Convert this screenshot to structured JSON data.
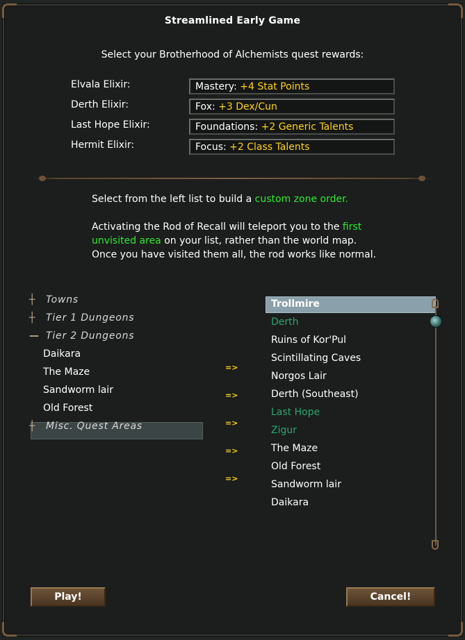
{
  "dialog": {
    "title": "Streamlined Early Game",
    "intro": "Select your Brotherhood of Alchemists quest rewards:"
  },
  "elixirs": [
    {
      "label": "Elvala Elixir:",
      "choice_prefix": "Mastery: ",
      "choice_value": "+4 Stat Points"
    },
    {
      "label": "Derth Elixir:",
      "choice_prefix": "Fox: ",
      "choice_value": "+3 Dex/Cun"
    },
    {
      "label": "Last Hope Elixir:",
      "choice_prefix": "Foundations: ",
      "choice_value": "+2 Generic Talents"
    },
    {
      "label": "Hermit Elixir:",
      "choice_prefix": "Focus: ",
      "choice_value": "+2 Class Talents"
    }
  ],
  "zone_help": {
    "line1_pre": "Select from the left list to build a ",
    "line1_hl": "custom zone order.",
    "p2_pre": " Activating the Rod of Recall will teleport you to the ",
    "p2_hl": "first unvisited area",
    "p2_post": " on your list, rather than the world map. Once you have visited them all, the rod works like normal."
  },
  "left_tree": {
    "categories": [
      {
        "label": "Towns",
        "expanded": false
      },
      {
        "label": "Tier  1  Dungeons",
        "expanded": false
      },
      {
        "label": "Tier  2  Dungeons",
        "expanded": true
      },
      {
        "label": "Misc.  Quest  Areas",
        "expanded": false
      }
    ],
    "tier2_items": [
      "Daikara",
      "The Maze",
      "Sandworm lair",
      "Old Forest"
    ],
    "selected": "Misc.  Quest  Areas"
  },
  "arrow_label": "=>",
  "zone_order": [
    {
      "name": "Trollmire",
      "selected": true
    },
    {
      "name": "Derth",
      "color": "teal"
    },
    {
      "name": "Ruins of Kor'Pul"
    },
    {
      "name": "Scintillating Caves"
    },
    {
      "name": "Norgos Lair"
    },
    {
      "name": "Derth (Southeast)"
    },
    {
      "name": "Last Hope",
      "color": "teal"
    },
    {
      "name": "Zigur",
      "color": "teal"
    },
    {
      "name": "The Maze"
    },
    {
      "name": "Old Forest"
    },
    {
      "name": "Sandworm lair"
    },
    {
      "name": "Daikara"
    }
  ],
  "buttons": {
    "play": "Play!",
    "cancel": "Cancel!"
  },
  "icons": {
    "collapsed": "plus-icon",
    "expanded": "minus-icon"
  },
  "colors": {
    "highlight_yellow": "#ffd21f",
    "highlight_green": "#33e833",
    "teal_item": "#2fa56e",
    "selection": "#8aa0aa"
  }
}
